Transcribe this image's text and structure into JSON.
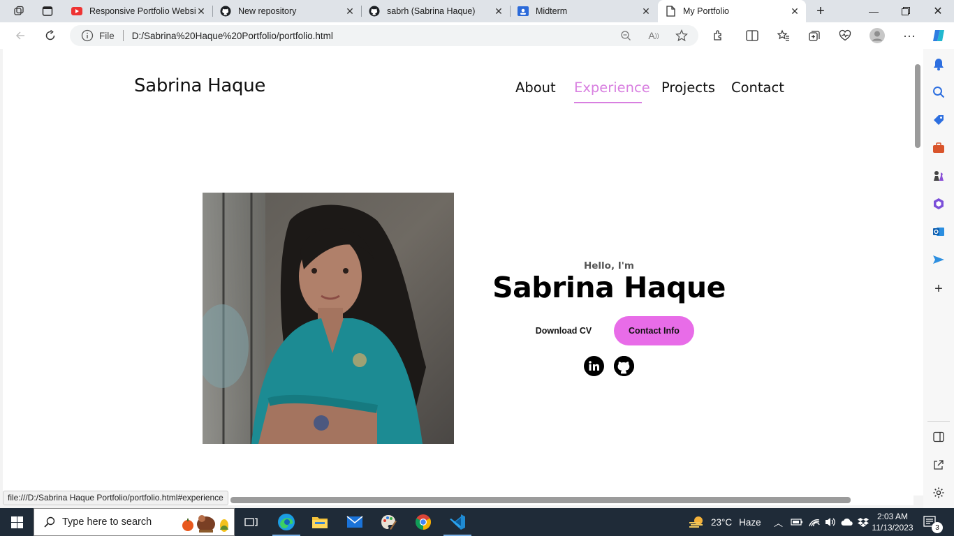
{
  "browser": {
    "tabs": [
      {
        "title": "Responsive Portfolio Websit",
        "icon": "youtube-icon",
        "active": false
      },
      {
        "title": "New repository",
        "icon": "github-icon",
        "active": false
      },
      {
        "title": "sabrh (Sabrina Haque)",
        "icon": "github-icon",
        "active": false
      },
      {
        "title": "Midterm",
        "icon": "google-classroom-icon",
        "active": false
      },
      {
        "title": "My Portfolio",
        "icon": "page-icon",
        "active": true
      }
    ],
    "address": {
      "scheme_label": "File",
      "url": "D:/Sabrina%20Haque%20Portfolio/portfolio.html"
    },
    "status_url": "file:///D:/Sabrina Haque Portfolio/portfolio.html#experience"
  },
  "page": {
    "logo": "Sabrina Haque",
    "nav": [
      {
        "label": "About",
        "active": false
      },
      {
        "label": "Experience",
        "active": true
      },
      {
        "label": "Projects",
        "active": false
      },
      {
        "label": "Contact",
        "active": false
      }
    ],
    "hero": {
      "greeting": "Hello, I'm",
      "name": "Sabrina Haque",
      "buttons": {
        "download_cv": "Download CV",
        "contact_info": "Contact Info"
      },
      "social": [
        "linkedin-icon",
        "github-icon"
      ]
    },
    "accent_color": "#d87fe0",
    "button_color": "#e86ce8"
  },
  "taskbar": {
    "search_placeholder": "Type here to search",
    "weather": {
      "temp": "23°C",
      "condition": "Haze"
    },
    "clock": {
      "time": "2:03 AM",
      "date": "11/13/2023"
    },
    "notifications": "3"
  }
}
